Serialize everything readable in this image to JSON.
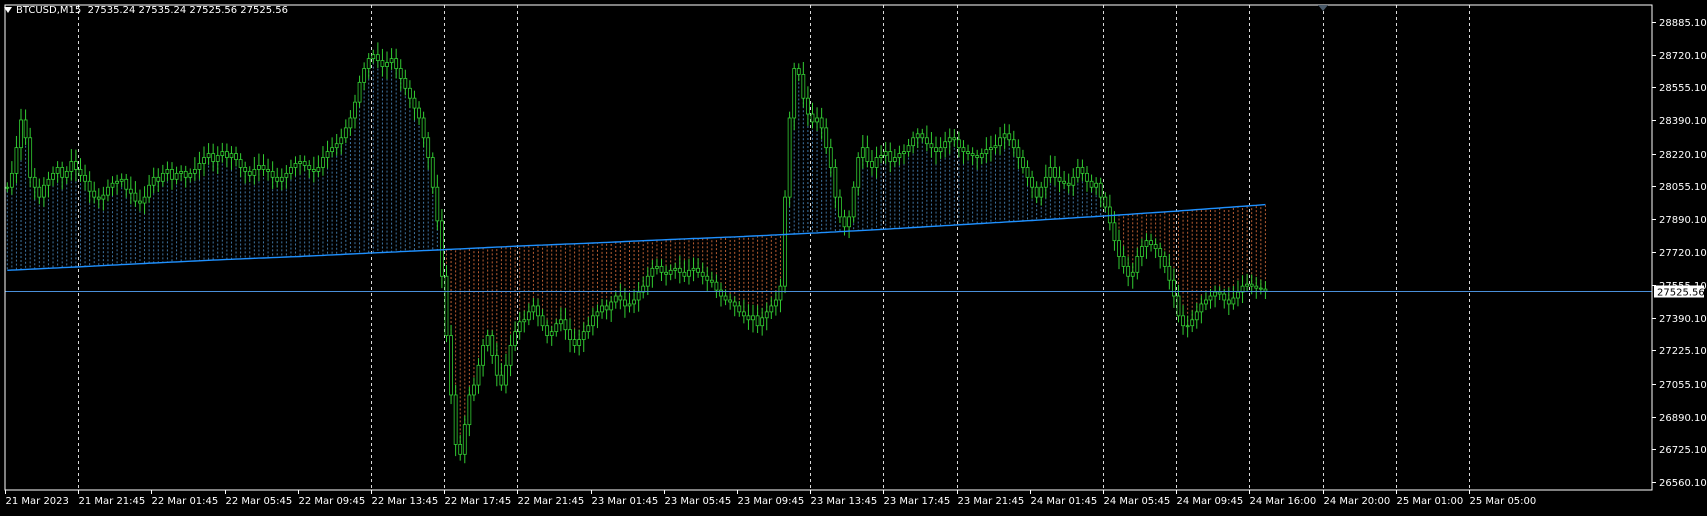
{
  "header": {
    "symbol": "BTCUSD,M15",
    "ohlc": "27535.24 27535.24 27525.56 27525.56"
  },
  "colors": {
    "background": "#000000",
    "frame": "#ffffff",
    "grid": "#ffffff",
    "candles": "#32cd32",
    "ma_line": "#1e90ff",
    "fill_above": "#4682b4",
    "fill_below": "#cd6839",
    "price_line": "#4a8fd9"
  },
  "chart_data": {
    "type": "line",
    "title": "BTCUSD,M15",
    "xlabel": "",
    "ylabel": "",
    "ylim": [
      26560.1,
      28885.1
    ],
    "grid": true,
    "current_price_label": "27525.56",
    "y_ticks": [
      "28885.10",
      "28720.10",
      "28555.10",
      "28390.10",
      "28220.10",
      "28055.10",
      "27890.10",
      "27720.10",
      "27555.10",
      "27390.10",
      "27225.10",
      "27055.10",
      "26890.10",
      "26725.10",
      "26560.10"
    ],
    "y_tick_values": [
      28885.1,
      28720.1,
      28555.1,
      28390.1,
      28220.1,
      28055.1,
      27890.1,
      27720.1,
      27555.1,
      27390.1,
      27225.1,
      27055.1,
      26890.1,
      26725.1,
      26560.1
    ],
    "x_ticks": [
      "21 Mar 2023",
      "21 Mar 21:45",
      "22 Mar 01:45",
      "22 Mar 05:45",
      "22 Mar 09:45",
      "22 Mar 13:45",
      "22 Mar 17:45",
      "22 Mar 21:45",
      "23 Mar 01:45",
      "23 Mar 05:45",
      "23 Mar 09:45",
      "23 Mar 13:45",
      "23 Mar 17:45",
      "23 Mar 21:45",
      "24 Mar 01:45",
      "24 Mar 05:45",
      "24 Mar 09:45",
      "24 Mar 16:00",
      "24 Mar 20:00",
      "25 Mar 01:00",
      "25 Mar 05:00"
    ],
    "x_tick_index": [
      0,
      16,
      32,
      48,
      64,
      80,
      96,
      112,
      128,
      144,
      160,
      176,
      192,
      208,
      224,
      240,
      256,
      272,
      288,
      304,
      320
    ],
    "vertical_grid_index": [
      16,
      80,
      96,
      112,
      176,
      192,
      208,
      240,
      256,
      272,
      288,
      304,
      320
    ],
    "series": [
      {
        "kind": "price",
        "values": [
          28050,
          28120,
          28250,
          28390,
          28300,
          28100,
          28050,
          28000,
          28060,
          28090,
          28120,
          28150,
          28100,
          28130,
          28180,
          28140,
          28110,
          28080,
          28030,
          28000,
          27990,
          28010,
          28050,
          28070,
          28080,
          28090,
          28040,
          28020,
          27980,
          27970,
          28000,
          28060,
          28100,
          28080,
          28120,
          28140,
          28090,
          28120,
          28130,
          28100,
          28120,
          28140,
          28170,
          28200,
          28220,
          28180,
          28210,
          28230,
          28200,
          28220,
          28190,
          28150,
          28130,
          28110,
          28140,
          28160,
          28140,
          28130,
          28100,
          28080,
          28100,
          28120,
          28150,
          28170,
          28180,
          28160,
          28140,
          28130,
          28150,
          28200,
          28230,
          28250,
          28270,
          28300,
          28350,
          28400,
          28480,
          28580,
          28650,
          28700,
          28720,
          28690,
          28660,
          28680,
          28700,
          28650,
          28600,
          28550,
          28500,
          28450,
          28400,
          28300,
          28200,
          28050,
          27880,
          27600,
          27300,
          27000,
          26750,
          26700,
          26850,
          27000,
          27050,
          27150,
          27250,
          27300,
          27200,
          27100,
          27050,
          27150,
          27250,
          27320,
          27370,
          27380,
          27420,
          27450,
          27400,
          27350,
          27300,
          27320,
          27360,
          27380,
          27330,
          27280,
          27250,
          27280,
          27320,
          27350,
          27400,
          27420,
          27450,
          27430,
          27470,
          27500,
          27480,
          27450,
          27460,
          27480,
          27520,
          27550,
          27600,
          27640,
          27650,
          27620,
          27610,
          27630,
          27640,
          27620,
          27600,
          27630,
          27640,
          27620,
          27600,
          27580,
          27570,
          27530,
          27500,
          27480,
          27470,
          27450,
          27420,
          27400,
          27380,
          27400,
          27350,
          27390,
          27420,
          27450,
          27480,
          27550,
          28000,
          28400,
          28650,
          28620,
          28500,
          28420,
          28380,
          28400,
          28350,
          28250,
          28150,
          28000,
          27900,
          27850,
          27900,
          28050,
          28200,
          28250,
          28180,
          28150,
          28200,
          28210,
          28230,
          28180,
          28200,
          28220,
          28230,
          28260,
          28300,
          28320,
          28300,
          28270,
          28250,
          28230,
          28250,
          28280,
          28300,
          28290,
          28250,
          28230,
          28220,
          28210,
          28200,
          28220,
          28240,
          28250,
          28260,
          28300,
          28320,
          28290,
          28250,
          28200,
          28150,
          28100,
          28050,
          28000,
          28050,
          28100,
          28150,
          28100,
          28080,
          28070,
          28060,
          28100,
          28150,
          28120,
          28080,
          28050,
          28070,
          28000,
          27950,
          27870,
          27780,
          27700,
          27650,
          27600,
          27620,
          27700,
          27750,
          27780,
          27760,
          27740,
          27700,
          27650,
          27580,
          27500,
          27400,
          27350,
          27350,
          27380,
          27420,
          27460,
          27480,
          27500,
          27520,
          27510,
          27480,
          27460,
          27490,
          27520,
          27550,
          27560,
          27550,
          27540,
          27535,
          27525
        ],
        "x_start_index": 0
      },
      {
        "kind": "moving_average",
        "values": [
          27630,
          27648,
          27667,
          27685,
          27700,
          27718,
          27735,
          27753,
          27768,
          27785,
          27800,
          27818,
          27838,
          27860,
          27882,
          27905,
          27930,
          27957,
          27985,
          28015,
          28030,
          27995,
          27965,
          27935,
          27910,
          27888,
          27868,
          27850,
          27833,
          27818,
          27803,
          27790,
          27780,
          27773,
          27768,
          27763,
          27757,
          27750,
          27742,
          27735,
          27720,
          27720,
          27750,
          27780,
          27800,
          27818,
          27835,
          27850,
          27865,
          27880,
          27895,
          27910,
          27925,
          27940,
          27955,
          27965,
          27975,
          27983,
          27990,
          27995,
          28000,
          28005,
          28010,
          28005,
          27998,
          27990,
          27980,
          27970,
          27960,
          27950,
          27943,
          27935,
          27925,
          27915,
          27903
        ],
        "x_index": [
          0,
          16,
          32,
          48,
          64,
          80,
          96,
          112,
          128,
          144,
          160,
          176,
          192,
          208,
          224,
          240,
          256,
          272,
          288,
          304,
          320,
          336,
          352,
          368,
          384,
          400,
          416,
          432,
          448,
          464,
          480,
          496,
          512,
          528,
          544,
          560,
          576,
          592,
          608,
          624,
          656,
          672,
          704,
          736,
          768,
          800,
          832,
          864,
          896,
          928,
          960,
          992,
          1024,
          1056,
          1088,
          1120,
          1152,
          1184,
          1216,
          1248,
          1280,
          1312,
          1344,
          1376,
          1408,
          1440,
          1472,
          1504,
          1536,
          1568,
          1600,
          1632,
          1664,
          1696,
          1728
        ]
      }
    ]
  }
}
